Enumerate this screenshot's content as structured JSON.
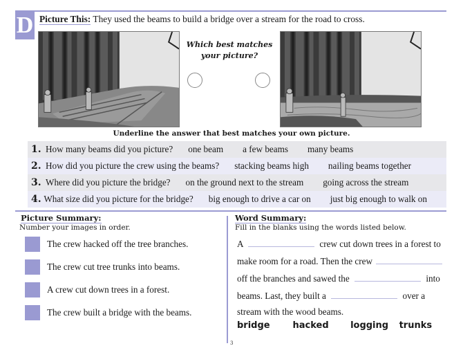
{
  "section_letter": "D",
  "picture_this": {
    "label": "Picture This:",
    "text": "They used the beams to build a bridge over a stream for the road to cross."
  },
  "images": {
    "left": {
      "description": "Two workers stand beside a wooden beam bridge crossing a stream in a tall forest"
    },
    "right": {
      "description": "Two workers stand by a stream in a tall forest with no bridge"
    }
  },
  "prompt": {
    "line1": "Which best matches",
    "line2": "your picture?"
  },
  "underline_instruction": "Underline the answer that best matches your own picture.",
  "questions": [
    {
      "number": "1.",
      "text": "How many beams did you picture?",
      "options": [
        "one beam",
        "a few beams",
        "many beams"
      ]
    },
    {
      "number": "2.",
      "text": "How did you picture the crew using the beams?",
      "options": [
        "stacking beams high",
        "nailing beams together"
      ]
    },
    {
      "number": "3.",
      "text": "Where did you picture the bridge?",
      "options": [
        "on the ground next to the stream",
        "going across the stream"
      ]
    },
    {
      "number": "4.",
      "text": "What size did you picture for the bridge?",
      "options": [
        "big enough to drive a car on",
        "just big enough to walk on"
      ]
    }
  ],
  "picture_summary": {
    "title": "Picture Summary:",
    "instruction": "Number your images in order.",
    "items": [
      "The crew hacked off the tree branches.",
      "The crew cut tree trunks into beams.",
      "A crew cut down trees in a forest.",
      "The crew built a bridge with the beams."
    ]
  },
  "word_summary": {
    "title": "Word Summary:",
    "instruction": "Fill in the blanks using the words listed below.",
    "lines": [
      {
        "before": "A",
        "after": "crew cut down trees in a forest to"
      },
      {
        "before": "make room for a road.  Then the crew",
        "after": ""
      },
      {
        "before": "off the branches and sawed the",
        "after": "into"
      },
      {
        "before": "beams.  Last, they built a",
        "after": "over a"
      },
      {
        "before": "stream with the wood beams.",
        "after": ""
      }
    ],
    "word_bank": [
      "bridge",
      "hacked",
      "logging",
      "trunks"
    ]
  },
  "page_number": "3",
  "colors": {
    "accent": "#9a9ad2",
    "row_gray": "#e7e7ea",
    "row_lavender": "#ebebf7"
  }
}
